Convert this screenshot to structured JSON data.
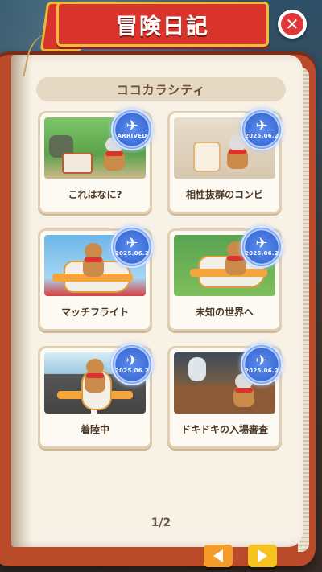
{
  "header": {
    "title": "冒険日記"
  },
  "close_button": {
    "icon": "close-icon",
    "glyph": "✕"
  },
  "chapter": {
    "title": "ココカラシティ"
  },
  "entries": [
    {
      "label": "これはなに?",
      "stamp": "ARRIVED",
      "stamp_icon": "plane-icon"
    },
    {
      "label": "相性抜群のコンビ",
      "stamp": "2025.06.2",
      "stamp_icon": "plane-icon"
    },
    {
      "label": "マッチフライト",
      "stamp": "2025.06.2",
      "stamp_icon": "plane-icon"
    },
    {
      "label": "未知の世界へ",
      "stamp": "2025.06.2",
      "stamp_icon": "plane-icon"
    },
    {
      "label": "着陸中",
      "stamp": "2025.06.2",
      "stamp_icon": "plane-icon"
    },
    {
      "label": "ドキドキの入場審査",
      "stamp": "2025.06.2",
      "stamp_icon": "plane-icon"
    }
  ],
  "pager": {
    "text": "1/2"
  },
  "nav": {
    "prev_icon": "arrow-left-icon",
    "next_icon": "arrow-right-icon"
  },
  "colors": {
    "header_red": "#d8342b",
    "gold": "#edbd3c",
    "cover": "#b94a2a",
    "page": "#f7f1e6"
  }
}
